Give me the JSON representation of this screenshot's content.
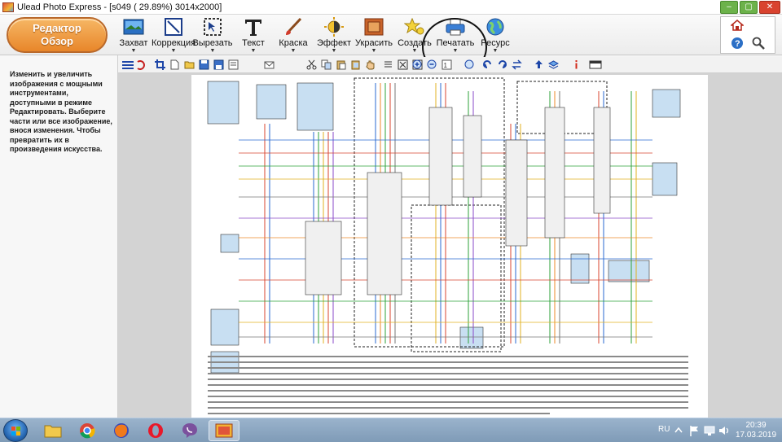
{
  "window": {
    "title": "Ulead Photo Express - [s049 ( 29.89%) 3014x2000]"
  },
  "mode": {
    "line1": "Редактор",
    "line2": "Обзор"
  },
  "tools": [
    {
      "label": "Захват",
      "icon": "capture-icon"
    },
    {
      "label": "Коррекция",
      "icon": "correction-icon"
    },
    {
      "label": "Вырезать",
      "icon": "cut-selection-icon"
    },
    {
      "label": "Текст",
      "icon": "text-icon"
    },
    {
      "label": "Краска",
      "icon": "paint-icon"
    },
    {
      "label": "Эффект",
      "icon": "effect-icon"
    },
    {
      "label": "Украсить",
      "icon": "decorate-icon"
    },
    {
      "label": "Создать",
      "icon": "create-icon"
    },
    {
      "label": "Печатать",
      "icon": "printer-icon"
    },
    {
      "label": "Ресурс",
      "icon": "resource-icon"
    }
  ],
  "info_panel": {
    "text": "Изменить и увеличить изображения с мощными инструментами, доступными в режиме Редактировать. Выберите части или все изображение, внося изменения. Чтобы превратить их в произведения искусства."
  },
  "taskbar": {
    "language": "RU",
    "time": "20:39",
    "date": "17.03.2019"
  },
  "colors": {
    "accent_orange": "#e8862a",
    "taskbar": "#8aa6c1",
    "close": "#d9432f"
  }
}
